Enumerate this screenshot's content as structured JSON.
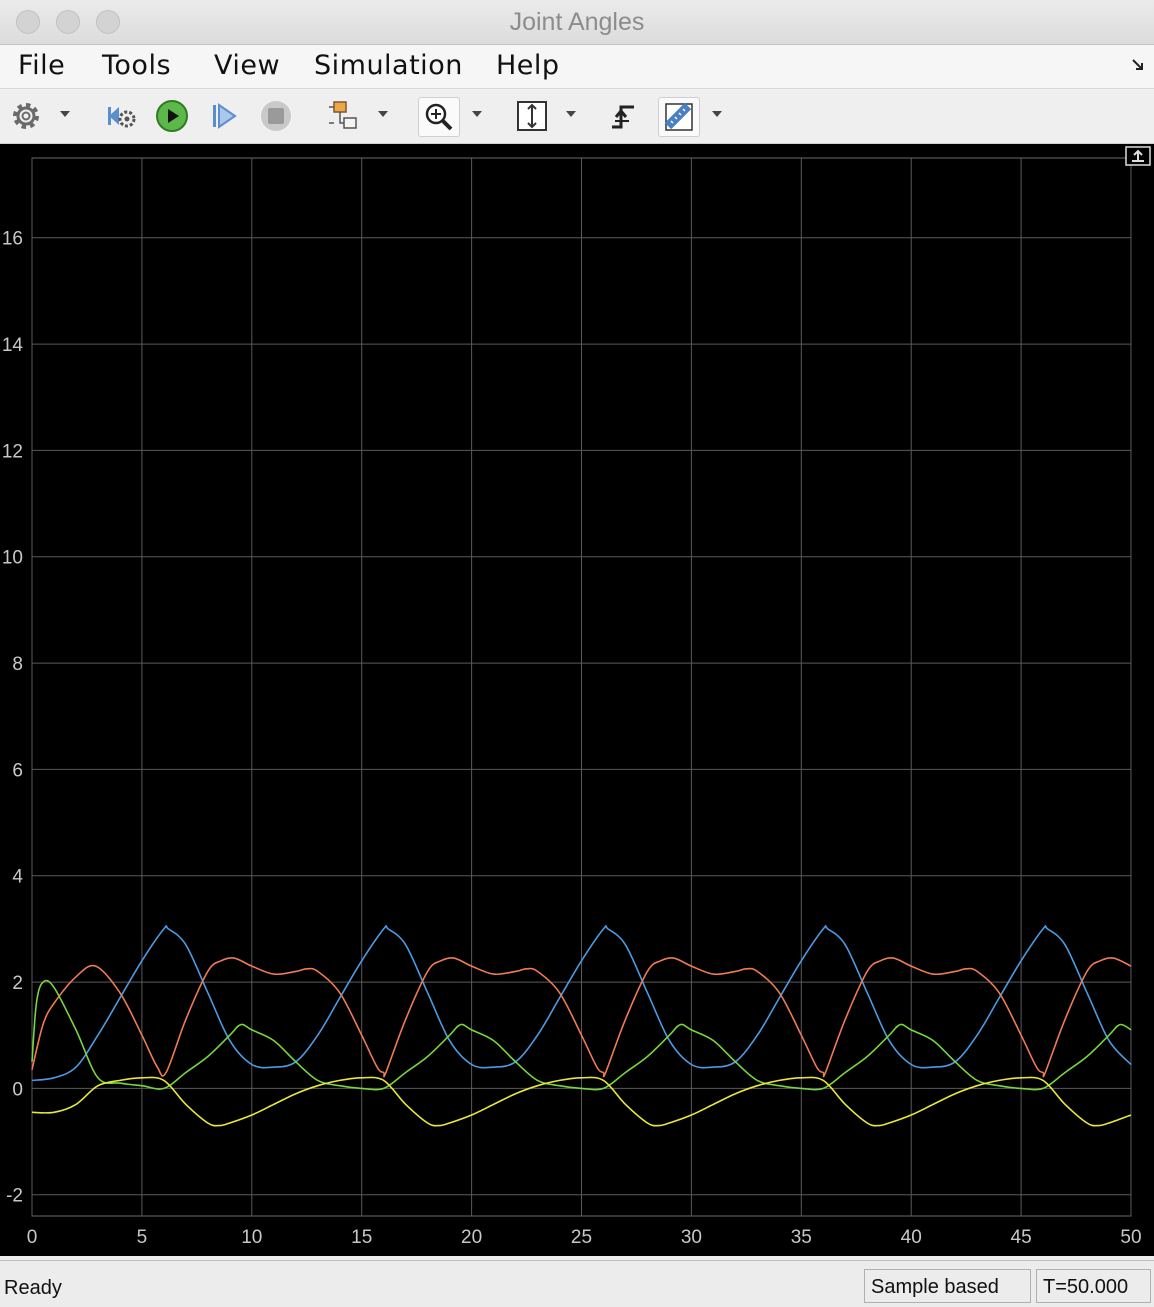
{
  "window": {
    "title": "Joint Angles"
  },
  "menu": [
    "File",
    "Tools",
    "View",
    "Simulation",
    "Help"
  ],
  "toolbar": {
    "icons": [
      "gear-icon",
      "step-back-icon",
      "run-icon",
      "step-forward-icon",
      "stop-icon",
      "signal-selector-icon",
      "zoom-in-icon",
      "scale-axes-icon",
      "triggers-icon",
      "measurements-icon"
    ]
  },
  "status": {
    "left": "Ready",
    "mode": "Sample based",
    "time": "T=50.000"
  },
  "colors": {
    "blue": "#4b9be3",
    "orange": "#ef7b55",
    "green": "#77d63e",
    "yellow": "#e8e83a",
    "grid": "#5a5a5a"
  },
  "chart_data": {
    "type": "line",
    "title": "",
    "xlabel": "",
    "ylabel": "",
    "xlim": [
      0,
      50
    ],
    "ylim": [
      -2.4,
      17.5
    ],
    "x_ticks": [
      "0",
      "5",
      "10",
      "15",
      "20",
      "25",
      "30",
      "35",
      "40",
      "45",
      "50"
    ],
    "y_ticks": [
      "-2",
      "0",
      "2",
      "4",
      "6",
      "8",
      "10",
      "12",
      "14",
      "16"
    ],
    "grid": true,
    "period": 10,
    "series": [
      {
        "color": "#4b9be3",
        "x": [
          0,
          1,
          2,
          3,
          4,
          5,
          6,
          6.2,
          7,
          8,
          9,
          10,
          11,
          12,
          13,
          14,
          15,
          16
        ],
        "y": [
          0.15,
          0.2,
          0.4,
          1.0,
          1.7,
          2.4,
          3.0,
          3.0,
          2.7,
          1.8,
          0.9,
          0.45,
          0.4,
          0.5,
          1.0,
          1.7,
          2.4,
          3.0
        ]
      },
      {
        "color": "#ef7b55",
        "x": [
          0,
          0.5,
          1,
          2,
          2.9,
          4,
          5,
          5.7,
          6.1,
          7,
          8,
          8.6,
          9.2,
          10,
          11,
          12,
          12.5,
          13,
          14,
          15,
          15.7,
          16
        ],
        "y": [
          0.35,
          1.2,
          1.6,
          2.1,
          2.3,
          1.8,
          1.0,
          0.4,
          0.3,
          1.3,
          2.2,
          2.4,
          2.45,
          2.3,
          2.15,
          2.2,
          2.25,
          2.2,
          1.8,
          1.0,
          0.4,
          0.3
        ]
      },
      {
        "color": "#77d63e",
        "x": [
          0,
          0.2,
          0.5,
          1,
          2,
          3,
          4,
          5,
          6,
          7,
          8,
          9,
          9.5,
          10,
          11,
          12,
          13,
          14,
          15,
          16
        ],
        "y": [
          0.5,
          1.6,
          2.0,
          1.9,
          1.1,
          0.2,
          0.1,
          0.05,
          0.0,
          0.3,
          0.6,
          1.0,
          1.2,
          1.1,
          0.9,
          0.5,
          0.15,
          0.05,
          0.0,
          0.0
        ]
      },
      {
        "color": "#e8e83a",
        "x": [
          0,
          1,
          2,
          3,
          4,
          5,
          6,
          7,
          8,
          8.5,
          9,
          10,
          11,
          12,
          13,
          14,
          15,
          16
        ],
        "y": [
          -0.45,
          -0.45,
          -0.3,
          0.05,
          0.15,
          0.2,
          0.15,
          -0.3,
          -0.65,
          -0.7,
          -0.65,
          -0.5,
          -0.3,
          -0.1,
          0.05,
          0.15,
          0.2,
          0.15
        ]
      }
    ]
  }
}
